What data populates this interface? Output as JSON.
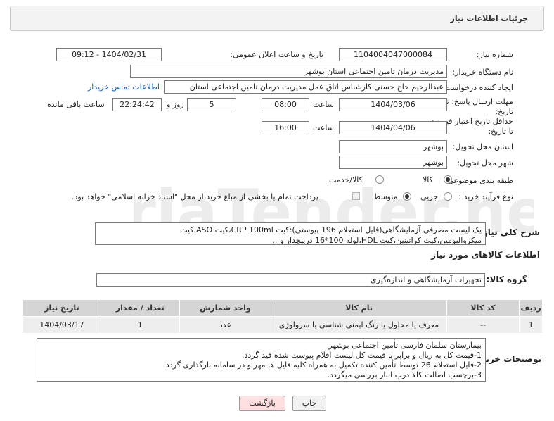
{
  "header": {
    "title": "جزئیات اطلاعات نیاز"
  },
  "fields": {
    "need_number_label": "شماره نیاز:",
    "need_number": "1104004047000084",
    "announce_label": "تاریخ و ساعت اعلان عمومی:",
    "announce_value": "1404/02/31 - 09:12",
    "buyer_label": "نام دستگاه خریدار:",
    "buyer_value": "مدیریت درمان تامین اجتماعی استان بوشهر",
    "creator_label": "ایجاد کننده درخواست:",
    "creator_value": "عبدالرحیم حاج حسنی کارشناس اتاق عمل مدیریت درمان تامین اجتماعی استان",
    "contact_link": "اطلاعات تماس خریدار",
    "reply_deadline_label": "مهلت ارسال پاسخ: تا تاریخ:",
    "reply_date": "1404/03/06",
    "time_label": "ساعت",
    "reply_time": "08:00",
    "days_value": "5",
    "days_label": "روز و",
    "remaining_time": "22:24:42",
    "remaining_label": "ساعت باقی مانده",
    "price_deadline_label": "حداقل تاریخ اعتبار قیمت: تا تاریخ:",
    "price_date": "1404/04/06",
    "price_time_label": "ساعت",
    "price_time": "16:00",
    "province_label": "استان محل تحویل:",
    "province_value": "بوشهر",
    "city_label": "شهر محل تحویل:",
    "city_value": "بوشهر",
    "category_label": "طبقه بندی موضوعی:",
    "category_options": [
      "کالا",
      "کالا/خدمت"
    ],
    "process_label": "نوع فرآیند خرید :",
    "process_options": [
      "جزیی",
      "متوسط"
    ],
    "payment_note": "پرداخت تمام یا بخشی از مبلغ خرید،از محل \"اسناد خزانه اسلامی\" خواهد بود."
  },
  "description": {
    "label": "شرح کلی نیاز:",
    "line1": "یک لیست مصرفی آزمایشگاهی(فایل استعلام 196 پیوستی):کیت CRP 100ml،کیت ASO،کیت",
    "line2": "میکروالبومین،کیت کراتینین،کیت HDL،لوله 100*16 درپیچدار و .."
  },
  "goods_section": {
    "title": "اطلاعات کالاهای مورد نیاز",
    "group_label": "گروه کالا:",
    "group_value": "تجهیزات آزمایشگاهی و اندازه‌گیری"
  },
  "table": {
    "headers": [
      "ردیف",
      "کد کالا",
      "نام کالا",
      "واحد شمارش",
      "تعداد / مقدار",
      "تاریخ نیاز"
    ],
    "rows": [
      [
        "1",
        "--",
        "معرف یا محلول یا رنگ ایمنی شناسی یا سرولوژی",
        "عدد",
        "1",
        "1404/03/17"
      ]
    ]
  },
  "buyer_notes": {
    "label": "توضیحات خریدار:",
    "lines": [
      "بیمارستان سلمان فارسی تأمین اجتماعی بوشهر",
      "1-قیمت کل به ریال و برابر با قیمت کل لیست اقلام پیوست شده قید گردد.",
      "2-فایل استعلام 26 توسط تأمین کننده تکمیل به همراه کلیه فایل ها مهر و در سامانه بارگذاری گردد.",
      "3-برچسب اصالت کالا درب انبار بررسی میگردد."
    ]
  },
  "buttons": {
    "print": "چاپ",
    "back": "بازگشت"
  },
  "colors": {
    "link": "#1b5fb4",
    "back_button_bg": "#ffe0e0",
    "table_header": "#d5d5d5"
  }
}
